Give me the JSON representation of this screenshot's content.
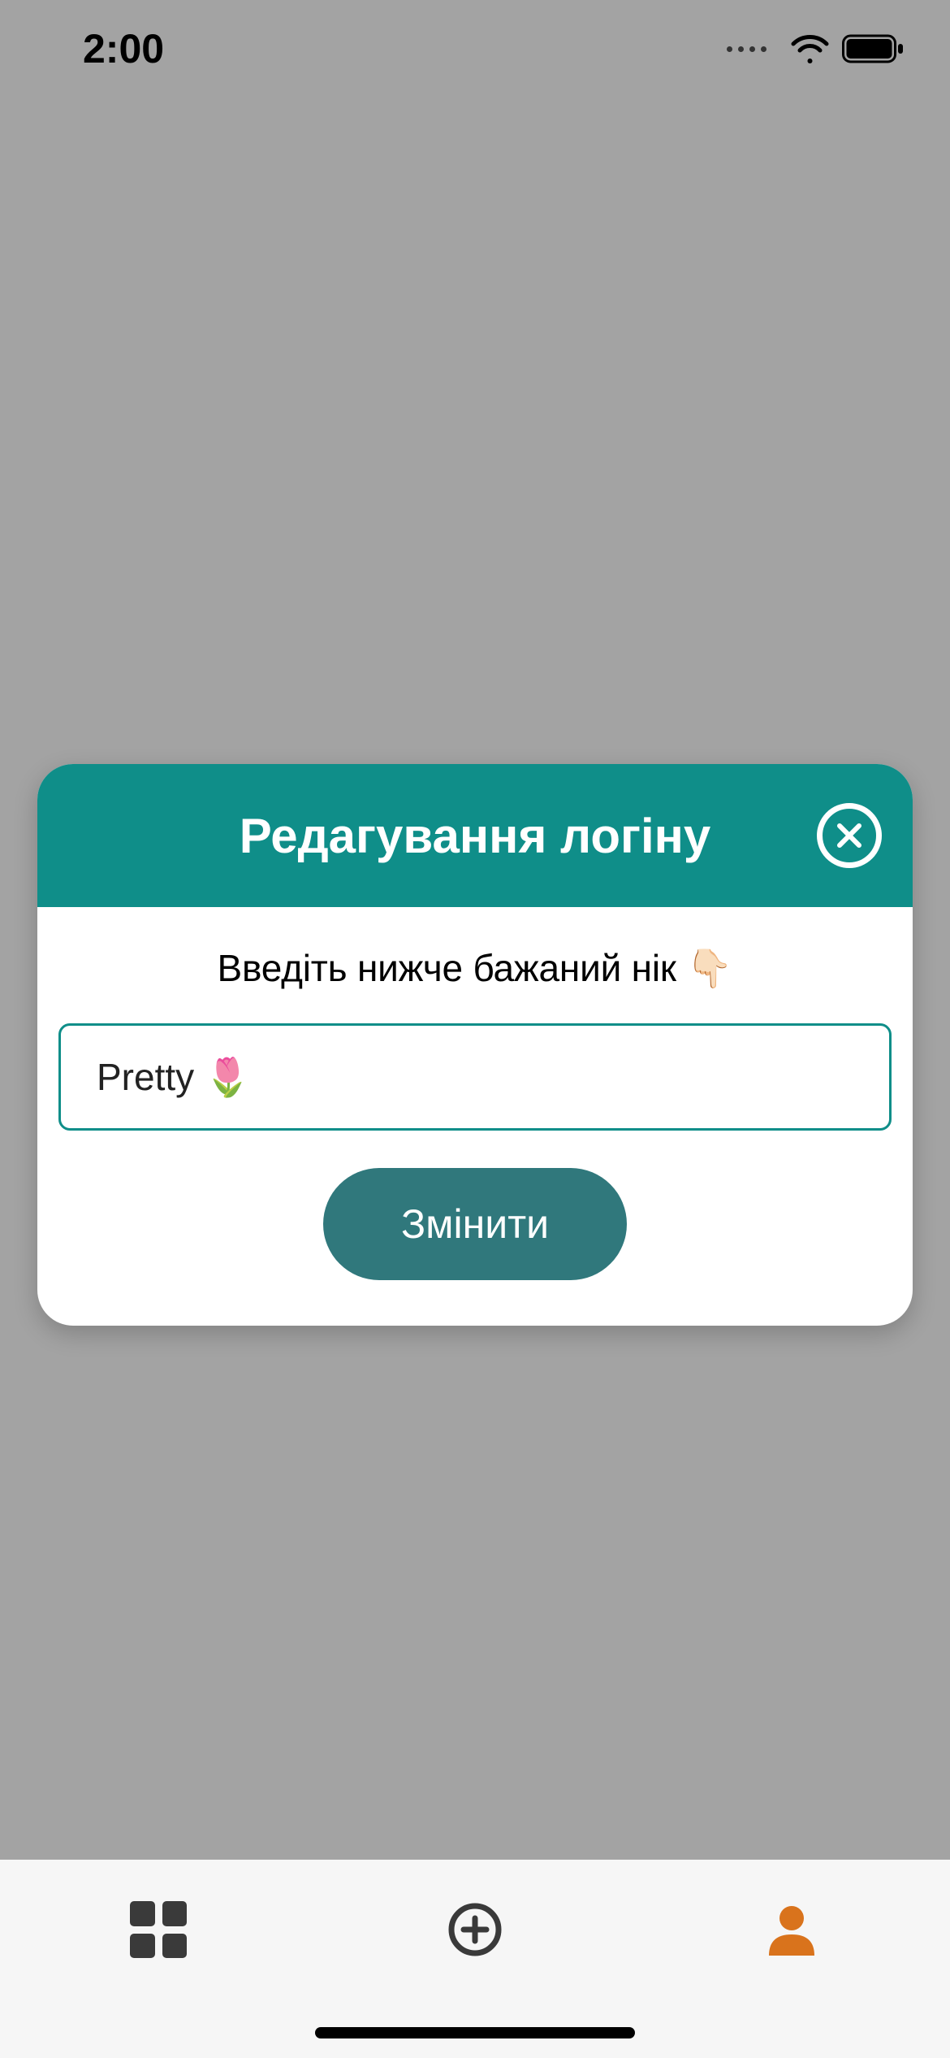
{
  "status_bar": {
    "time": "2:00"
  },
  "modal": {
    "title": "Редагування логіну",
    "subtitle": "Введіть нижче бажаний нік 👇🏻",
    "input_value": "Pretty 🌷",
    "submit_label": "Змінити"
  },
  "tabs": {
    "items": [
      {
        "name": "grid",
        "active": false
      },
      {
        "name": "add",
        "active": false
      },
      {
        "name": "profile",
        "active": true
      }
    ]
  },
  "colors": {
    "teal_header": "#0f8e89",
    "teal_button": "#30787c",
    "active_tab": "#d9731c"
  }
}
